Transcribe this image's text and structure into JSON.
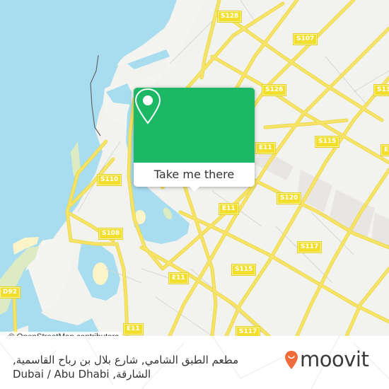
{
  "map": {
    "colors": {
      "water": "#a8dcef",
      "land": "#f2f2ef",
      "road": "#f6e46a",
      "road_outline": "#eed94a",
      "minor_road": "#d6d6d3",
      "park": "#dcebc2",
      "sand": "#fbf4c8",
      "building_block": "#e9e5e3"
    },
    "road_labels": [
      {
        "id": "s128",
        "text": "S128"
      },
      {
        "id": "s107",
        "text": "S107"
      },
      {
        "id": "s126",
        "text": "S126"
      },
      {
        "id": "s13x",
        "text": "S13"
      },
      {
        "id": "s115-top",
        "text": "S115"
      },
      {
        "id": "e11-right",
        "text": "E"
      },
      {
        "id": "e11-a",
        "text": "E11"
      },
      {
        "id": "s110",
        "text": "S110"
      },
      {
        "id": "s120",
        "text": "S120"
      },
      {
        "id": "e11-b",
        "text": "E11"
      },
      {
        "id": "s108",
        "text": "S108"
      },
      {
        "id": "s117-a",
        "text": "S117"
      },
      {
        "id": "s115-mid",
        "text": "S115"
      },
      {
        "id": "e11-c",
        "text": "E11"
      },
      {
        "id": "d92",
        "text": "D92"
      },
      {
        "id": "s117-b",
        "text": "S117"
      },
      {
        "id": "e11-d",
        "text": "E11"
      }
    ],
    "attribution": "© OpenStreetMap contributors"
  },
  "popup": {
    "button_label": "Take me there",
    "icon": "map-pin-icon",
    "color": "#1db866"
  },
  "footer": {
    "address_line1": "مطعم الطبق الشامي, شارع بلال بن رباح القاسمية,",
    "address_line2": "الشارقة, Dubai / Abu Dhabi",
    "logo_text": "moovit",
    "logo_color": "#f26b3a"
  }
}
